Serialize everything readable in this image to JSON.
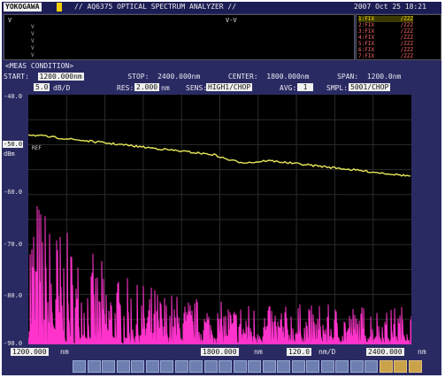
{
  "header": {
    "brand": "YOKOGAWA",
    "title": "// AQ6375 OPTICAL SPECTRUM ANALYZER //",
    "datetime": "2007 Oct 25 18:21"
  },
  "info": {
    "col_v": "V",
    "col_hint": "V-V",
    "rows": [
      "V",
      "V",
      "V",
      "V",
      "V"
    ]
  },
  "markers": {
    "rows": [
      {
        "label": "1:FIX",
        "value": "/ZZZ",
        "color": "#ffe000"
      },
      {
        "label": "2:FIX",
        "value": "/ZZZ",
        "color": "#ff6a6a"
      },
      {
        "label": "3:FIX",
        "value": "/ZZZ",
        "color": "#ff6a6a"
      },
      {
        "label": "4:FIX",
        "value": "/ZZZ",
        "color": "#ff6a6a"
      },
      {
        "label": "5:FIX",
        "value": "/ZZZ",
        "color": "#ff6a6a"
      },
      {
        "label": "6:FIX",
        "value": "/ZZZ",
        "color": "#ff6a6a"
      },
      {
        "label": "7:FIX",
        "value": "/ZZZ",
        "color": "#ff6a6a"
      }
    ]
  },
  "sweep": {
    "title": "<MEAS CONDITION>",
    "start_label": "START:",
    "start_value": "1200.000nm",
    "stop_label": "STOP:",
    "stop_value": "2400.000nm",
    "center_label": "CENTER:",
    "center_value": "1800.000nm",
    "span_label": "SPAN:",
    "span_value": "1200.0nm"
  },
  "settings": {
    "scale": "5.0",
    "scale_unit": "dB/D",
    "res_label": "RES:",
    "res_value": "2.000",
    "res_unit": "nm",
    "sens_label": "SENS:",
    "sens_value": "HIGH1/CHOP",
    "avg_label": "AVG:",
    "avg_value": "1",
    "smpl_label": "SMPL:",
    "smpl_value": "5001/CHOP"
  },
  "y_axis": {
    "labels": [
      "-40.0",
      "-50.0",
      "-60.0",
      "-70.0",
      "-80.0",
      "-90.0"
    ],
    "unit": "dBm",
    "ref_label": "REF",
    "ref_value": "-50.0"
  },
  "bottom": {
    "start": "1200.000",
    "start_unit": "nm",
    "center": "1800.000",
    "center_unit": "nm",
    "div": "120.0",
    "div_unit": "nm/D",
    "stop": "2400.000",
    "stop_unit": "nm"
  },
  "softkeys": [
    "",
    "",
    "",
    "",
    "",
    "",
    "",
    "",
    "",
    "",
    "",
    "",
    "",
    "",
    "",
    "",
    "",
    "",
    "",
    "",
    "",
    "",
    "",
    ""
  ],
  "colors": {
    "trace_a": "#e8e85a",
    "trace_b": "#ff33cc",
    "plot_bg": "#000000",
    "frame_bg": "#2a2a63"
  }
}
